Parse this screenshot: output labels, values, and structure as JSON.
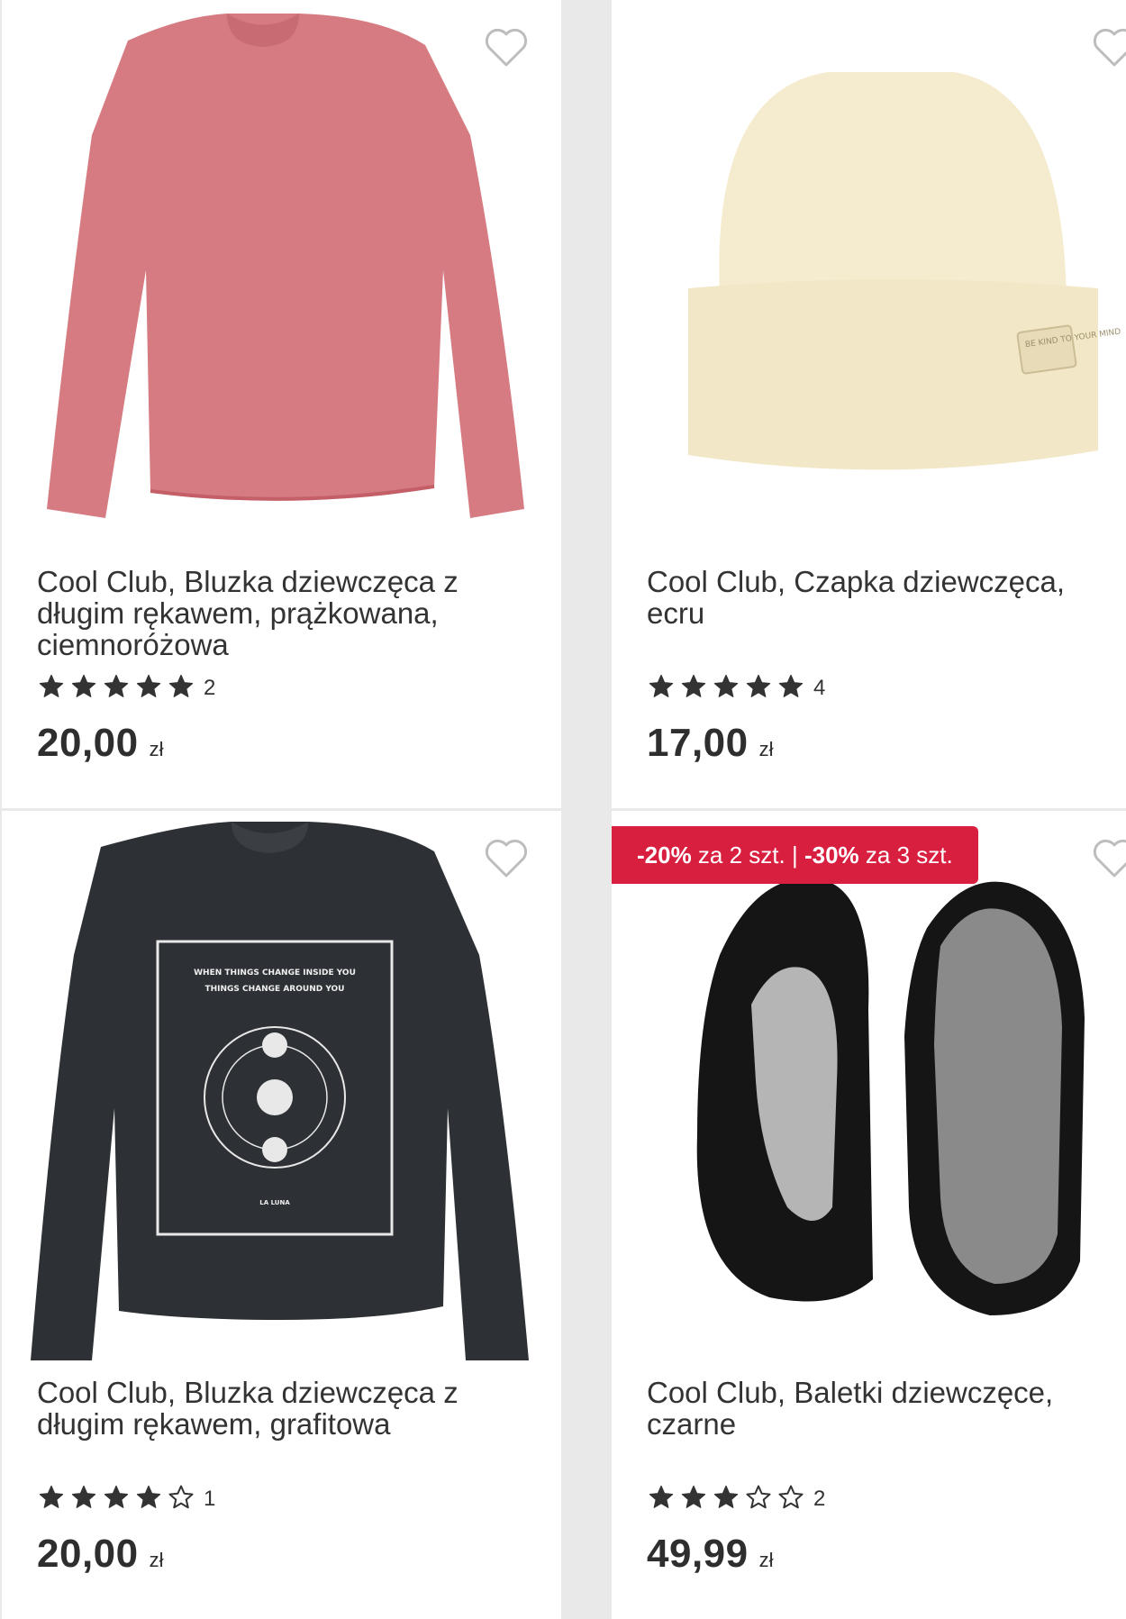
{
  "colors": {
    "promo_bg": "#d91f40",
    "star": "#333333",
    "text": "#333333"
  },
  "products": [
    {
      "title": "Cool Club, Bluzka dziewczęca z długim rękawem, prążkowana, ciemnoróżowa",
      "rating": 5,
      "rating_count": "2",
      "price": "20,00",
      "currency": "zł",
      "image": "pink-ribbed-long-sleeve-top"
    },
    {
      "title": "Cool Club, Czapka dziewczęca, ecru",
      "rating": 5,
      "rating_count": "4",
      "price": "17,00",
      "currency": "zł",
      "image": "ecru-knit-beanie",
      "image_label": "BE KIND TO YOUR MIND"
    },
    {
      "title": "Cool Club, Bluzka dziewczęca z długim rękawem, grafitowa",
      "rating": 4,
      "rating_count": "1",
      "price": "20,00",
      "currency": "zł",
      "image": "graphite-long-sleeve-top-moon-print",
      "print_lines": [
        "WHEN THINGS CHANGE INSIDE YOU",
        "THINGS CHANGE AROUND YOU",
        "LA LUNA"
      ]
    },
    {
      "title": "Cool Club, Baletki dziewczęce, czarne",
      "rating": 3,
      "rating_count": "2",
      "price": "49,99",
      "currency": "zł",
      "image": "black-ballet-slippers",
      "promo": {
        "d1": "-20%",
        "t1": " za 2 szt. | ",
        "d2": "-30%",
        "t2": " za 3 szt."
      }
    }
  ]
}
